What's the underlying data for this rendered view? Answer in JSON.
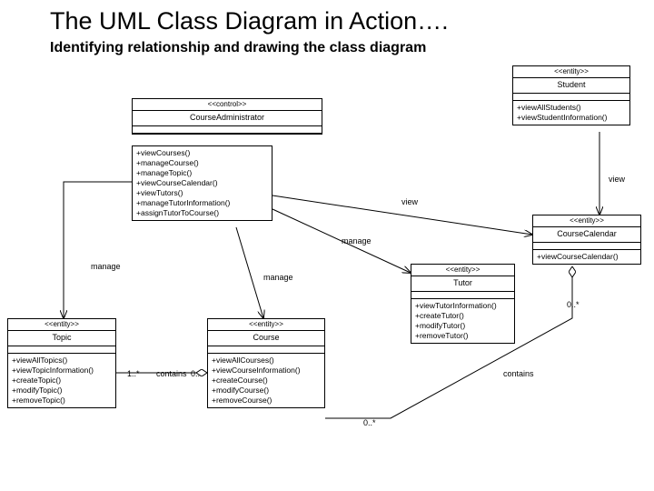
{
  "title": "The UML Class Diagram in Action….",
  "subtitle": "Identifying relationship and drawing the class diagram",
  "stereotypes": {
    "entity": "<<entity>>",
    "control": "<<control>>"
  },
  "classes": {
    "courseAdministrator": {
      "name": "CourseAdministrator",
      "ops": [
        "+viewCourses()",
        "+manageCourse()",
        "+manageTopic()",
        "+viewCourseCalendar()",
        "+viewTutors()",
        "+manageTutorInformation()",
        "+assignTutorToCourse()"
      ]
    },
    "student": {
      "name": "Student",
      "ops": [
        "+viewAllStudents()",
        "+viewStudentInformation()"
      ]
    },
    "courseCalendar": {
      "name": "CourseCalendar",
      "ops": [
        "+viewCourseCalendar()"
      ]
    },
    "tutor": {
      "name": "Tutor",
      "ops": [
        "+viewTutorInformation()",
        "+createTutor()",
        "+modifyTutor()",
        "+removeTutor()"
      ]
    },
    "topic": {
      "name": "Topic",
      "ops": [
        "+viewAllTopics()",
        "+viewTopicInformation()",
        "+createTopic()",
        "+modifyTopic()",
        "+removeTopic()"
      ]
    },
    "course": {
      "name": "Course",
      "ops": [
        "+viewAllCourses()",
        "+viewCourseInformation()",
        "+createCourse()",
        "+modifyCourse()",
        "+removeCourse()"
      ]
    }
  },
  "relations": {
    "manage1": "manage",
    "manage2": "manage",
    "manage3": "manage",
    "view1": "view",
    "view2": "view",
    "contains1": "contains",
    "contains2": "contains",
    "m1": "1..*",
    "m2": "0..*",
    "m3": "0..*",
    "m4": "0..*"
  }
}
